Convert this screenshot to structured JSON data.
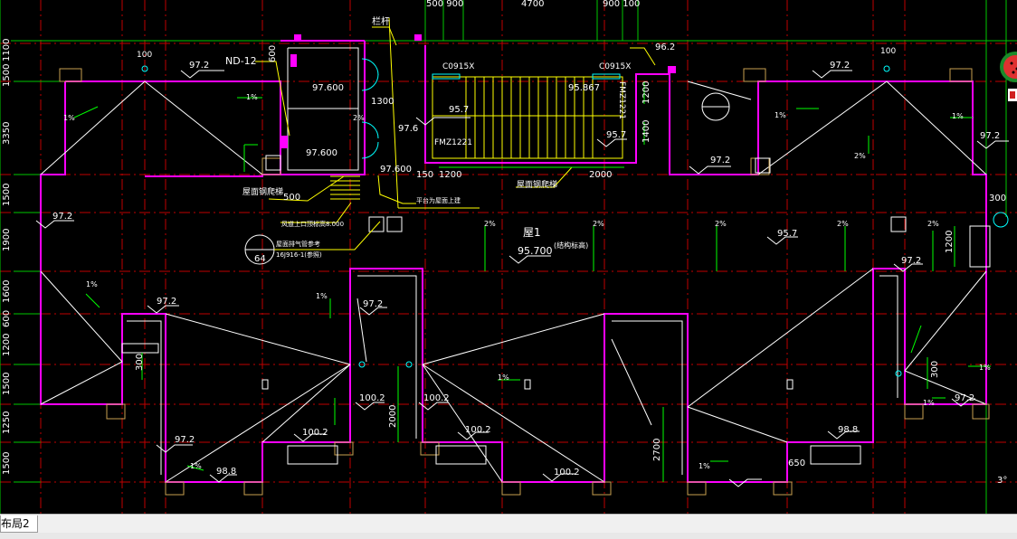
{
  "drawing": {
    "roof_label": "屋1",
    "roof_elevation": "95.700",
    "roof_elevation_note": "(结构标高)",
    "top_dims": [
      "500 900",
      "4700",
      "900 100"
    ],
    "left_dims": [
      "1500",
      "1100",
      "3350",
      "1500",
      "1900",
      "1600",
      "600",
      "1200",
      "1500",
      "1250",
      "1500"
    ],
    "room_labels": [
      "栏杆",
      "ND-12",
      "97.600",
      "97.600",
      "1300",
      "97.6",
      "97.600",
      "500",
      "屋面钢爬梯",
      "屋面钢爬梯",
      "风道上口顶标高8.000",
      "屋面排气管参考",
      "16J916-1(参照)",
      "平台为屋面上建"
    ],
    "stair_labels": [
      "C0915X",
      "C0915X",
      "95.867",
      "95.7",
      "95.7",
      "FMZ1221",
      "FMZ1221",
      "150",
      "1200",
      "2000",
      "1200",
      "1400",
      "96.2"
    ],
    "elevations": [
      "97.2",
      "97.2",
      "97.2",
      "97.2",
      "97.2",
      "97.2",
      "97.2",
      "97.2",
      "97.2",
      "97.2",
      "95.7",
      "100.2",
      "100.2",
      "100.2",
      "100.2",
      "100.2",
      "98.8",
      "98.8"
    ],
    "slopes": [
      "1%",
      "1%",
      "1%",
      "1%",
      "1%",
      "1%",
      "1%",
      "1%",
      "2%",
      "2%",
      "2%",
      "2%",
      "2%",
      "2%",
      "2%",
      "1%",
      "1%",
      "1%"
    ],
    "drain_labels": [
      "100",
      "100"
    ],
    "callout_64": "64",
    "misc_dims": [
      "2000",
      "2700",
      "1200",
      "300",
      "300",
      "300",
      "600",
      "650",
      "3°"
    ],
    "dim_300_right": "300",
    "dim_1200_right": "1200"
  },
  "layout_tab": {
    "label": "布局2"
  },
  "colors": {
    "wall": "#ff00ff",
    "axis": "#00ff00",
    "text": "#ffffff",
    "dim": "#00ff00",
    "hatch": "#ffff00",
    "grid": "#ff0000",
    "bg": "#000000"
  }
}
